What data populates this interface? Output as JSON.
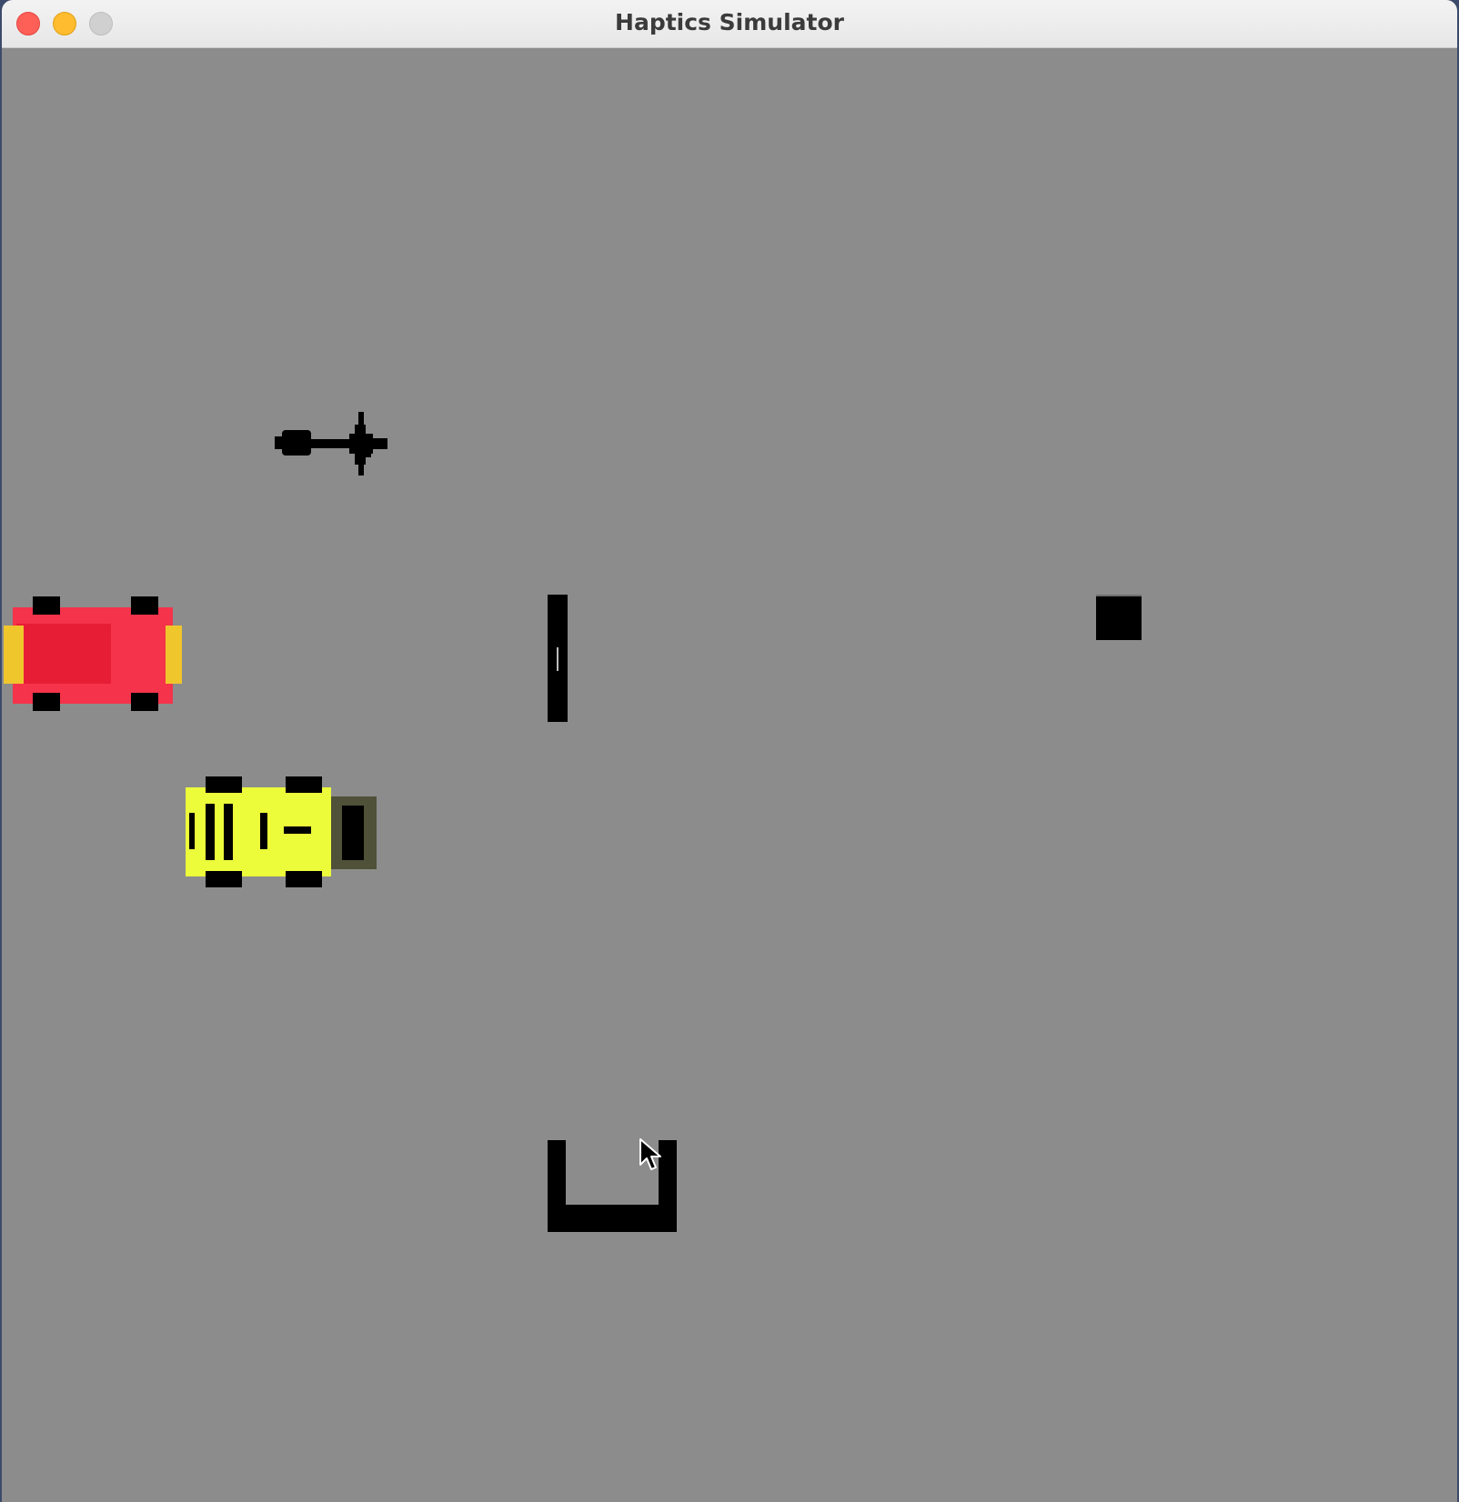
{
  "window": {
    "title": "Haptics Simulator"
  },
  "colors": {
    "background": "#8c8c8c",
    "sprite": "#000000",
    "red_car": "#f5334a",
    "yellow_car": "#ecfb3a"
  },
  "icons": {
    "close": "close-icon",
    "minimize": "minimize-icon",
    "zoom": "zoom-icon",
    "cursor": "mouse-cursor-icon"
  }
}
